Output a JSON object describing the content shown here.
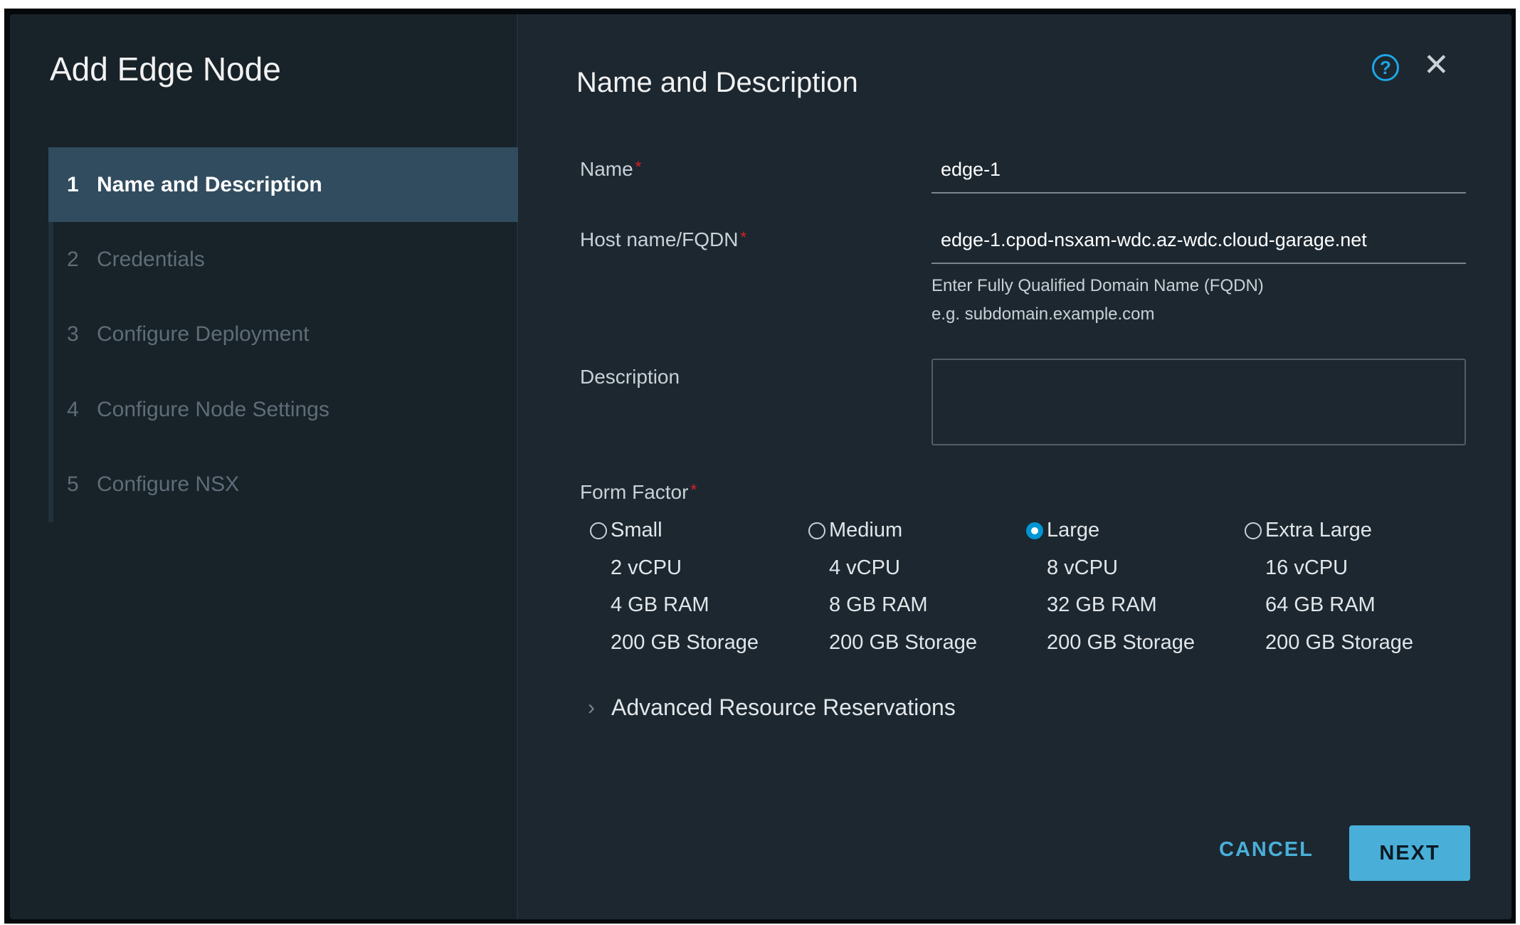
{
  "dialog": {
    "title": "Add Edge Node"
  },
  "steps": [
    {
      "num": "1",
      "label": "Name and Description",
      "active": true
    },
    {
      "num": "2",
      "label": "Credentials"
    },
    {
      "num": "3",
      "label": "Configure Deployment"
    },
    {
      "num": "4",
      "label": "Configure Node Settings"
    },
    {
      "num": "5",
      "label": "Configure NSX"
    }
  ],
  "content": {
    "heading": "Name and Description",
    "help_icon": "help-circle-icon",
    "close_icon": "close-icon",
    "name": {
      "label": "Name",
      "required": "*",
      "value": "edge-1"
    },
    "host": {
      "label": "Host name/FQDN",
      "required": "*",
      "value": "edge-1.cpod-nsxam-wdc.az-wdc.cloud-garage.net",
      "help1": "Enter Fully Qualified Domain Name (FQDN)",
      "help2": "e.g. subdomain.example.com"
    },
    "description": {
      "label": "Description",
      "value": ""
    },
    "form_factor": {
      "label": "Form Factor",
      "required": "*",
      "selected": "Large",
      "options": [
        {
          "name": "Small",
          "cpu": "2 vCPU",
          "ram": "4 GB RAM",
          "storage": "200 GB Storage"
        },
        {
          "name": "Medium",
          "cpu": "4 vCPU",
          "ram": "8 GB RAM",
          "storage": "200 GB Storage"
        },
        {
          "name": "Large",
          "cpu": "8 vCPU",
          "ram": "32 GB RAM",
          "storage": "200 GB Storage"
        },
        {
          "name": "Extra Large",
          "cpu": "16 vCPU",
          "ram": "64 GB RAM",
          "storage": "200 GB Storage"
        }
      ]
    },
    "advanced": "Advanced Resource Reservations"
  },
  "footer": {
    "cancel": "CANCEL",
    "next": "NEXT"
  },
  "colors": {
    "accent": "#49afd9",
    "required": "#e02020",
    "active_step": "#314c5f"
  }
}
